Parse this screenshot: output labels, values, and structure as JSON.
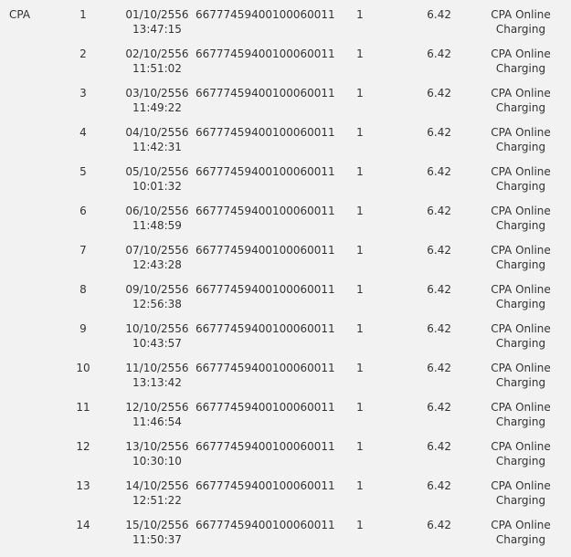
{
  "group_label": "CPA",
  "rows": [
    {
      "no": "1",
      "date": "01/10/2556",
      "time": "13:47:15",
      "number": "66777459400100060011",
      "qty": "1",
      "amount": "6.42",
      "service_line1": "CPA Online",
      "service_line2": "Charging"
    },
    {
      "no": "2",
      "date": "02/10/2556",
      "time": "11:51:02",
      "number": "66777459400100060011",
      "qty": "1",
      "amount": "6.42",
      "service_line1": "CPA Online",
      "service_line2": "Charging"
    },
    {
      "no": "3",
      "date": "03/10/2556",
      "time": "11:49:22",
      "number": "66777459400100060011",
      "qty": "1",
      "amount": "6.42",
      "service_line1": "CPA Online",
      "service_line2": "Charging"
    },
    {
      "no": "4",
      "date": "04/10/2556",
      "time": "11:42:31",
      "number": "66777459400100060011",
      "qty": "1",
      "amount": "6.42",
      "service_line1": "CPA Online",
      "service_line2": "Charging"
    },
    {
      "no": "5",
      "date": "05/10/2556",
      "time": "10:01:32",
      "number": "66777459400100060011",
      "qty": "1",
      "amount": "6.42",
      "service_line1": "CPA Online",
      "service_line2": "Charging"
    },
    {
      "no": "6",
      "date": "06/10/2556",
      "time": "11:48:59",
      "number": "66777459400100060011",
      "qty": "1",
      "amount": "6.42",
      "service_line1": "CPA Online",
      "service_line2": "Charging"
    },
    {
      "no": "7",
      "date": "07/10/2556",
      "time": "12:43:28",
      "number": "66777459400100060011",
      "qty": "1",
      "amount": "6.42",
      "service_line1": "CPA Online",
      "service_line2": "Charging"
    },
    {
      "no": "8",
      "date": "09/10/2556",
      "time": "12:56:38",
      "number": "66777459400100060011",
      "qty": "1",
      "amount": "6.42",
      "service_line1": "CPA Online",
      "service_line2": "Charging"
    },
    {
      "no": "9",
      "date": "10/10/2556",
      "time": "10:43:57",
      "number": "66777459400100060011",
      "qty": "1",
      "amount": "6.42",
      "service_line1": "CPA Online",
      "service_line2": "Charging"
    },
    {
      "no": "10",
      "date": "11/10/2556",
      "time": "13:13:42",
      "number": "66777459400100060011",
      "qty": "1",
      "amount": "6.42",
      "service_line1": "CPA Online",
      "service_line2": "Charging"
    },
    {
      "no": "11",
      "date": "12/10/2556",
      "time": "11:46:54",
      "number": "66777459400100060011",
      "qty": "1",
      "amount": "6.42",
      "service_line1": "CPA Online",
      "service_line2": "Charging"
    },
    {
      "no": "12",
      "date": "13/10/2556",
      "time": "10:30:10",
      "number": "66777459400100060011",
      "qty": "1",
      "amount": "6.42",
      "service_line1": "CPA Online",
      "service_line2": "Charging"
    },
    {
      "no": "13",
      "date": "14/10/2556",
      "time": "12:51:22",
      "number": "66777459400100060011",
      "qty": "1",
      "amount": "6.42",
      "service_line1": "CPA Online",
      "service_line2": "Charging"
    },
    {
      "no": "14",
      "date": "15/10/2556",
      "time": "11:50:37",
      "number": "66777459400100060011",
      "qty": "1",
      "amount": "6.42",
      "service_line1": "CPA Online",
      "service_line2": "Charging"
    }
  ]
}
